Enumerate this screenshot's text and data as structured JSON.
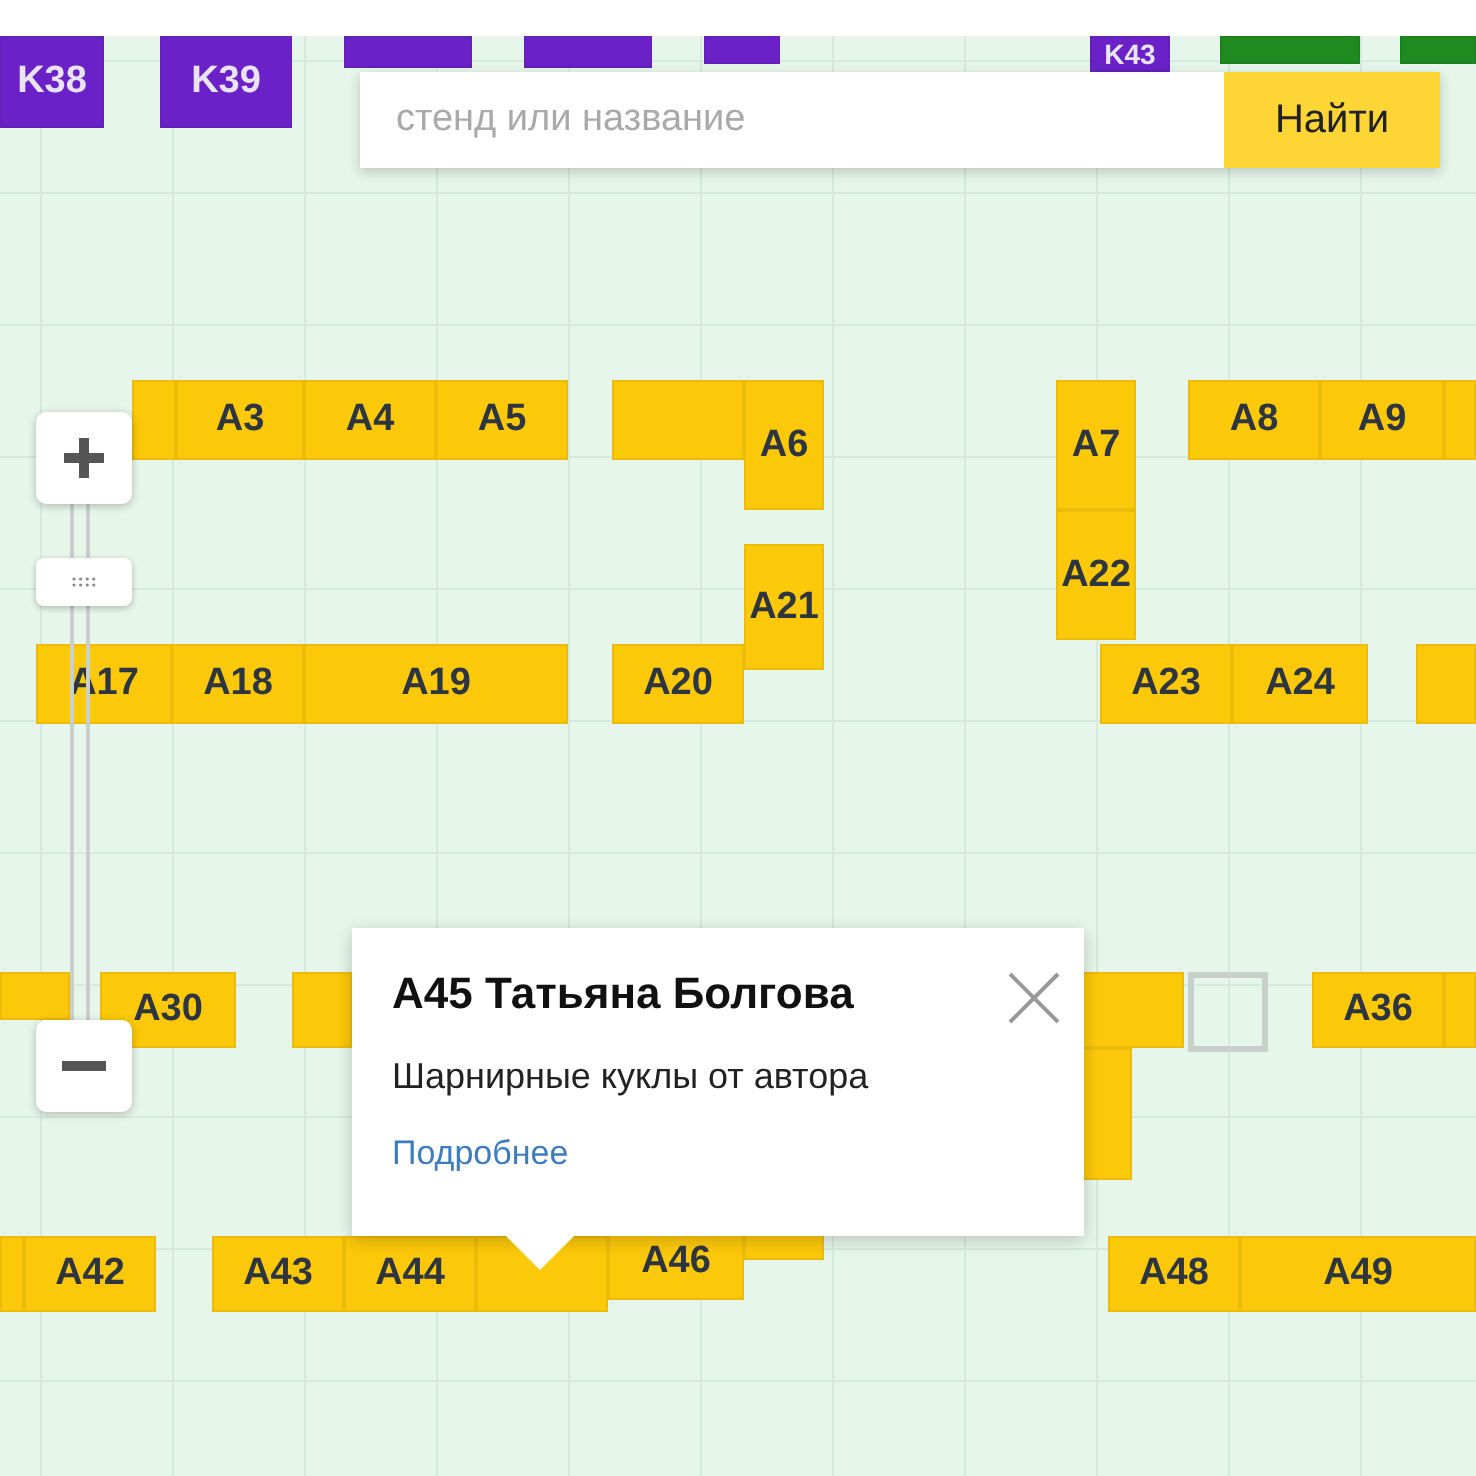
{
  "search": {
    "placeholder": "стенд или название",
    "button": "Найти"
  },
  "booths": [
    {
      "label": "K38",
      "kind": "stand",
      "color": "#6a22c8"
    },
    {
      "label": "K39",
      "kind": "stand",
      "color": "#6a22c8"
    },
    {
      "kind": "stand",
      "color": "#6a22c8"
    },
    {
      "kind": "stand",
      "color": "#6a22c8"
    },
    {
      "kind": "stand",
      "color": "#6a22c8"
    },
    {
      "label": "K43",
      "kind": "stand",
      "color": "#6a22c8"
    },
    {
      "kind": "stand",
      "color": "#1f8a1f"
    },
    {
      "kind": "stand",
      "color": "#1f8a1f"
    },
    {
      "kind": "stand",
      "color": "#fcc80a"
    },
    {
      "label": "A3",
      "kind": "stand",
      "color": "#fcc80a"
    },
    {
      "label": "A4",
      "kind": "stand",
      "color": "#fcc80a"
    },
    {
      "label": "A5",
      "kind": "stand",
      "color": "#fcc80a"
    },
    {
      "kind": "stand",
      "color": "#fcc80a"
    },
    {
      "label": "A6",
      "kind": "stand",
      "color": "#fcc80a"
    },
    {
      "label": "A21",
      "kind": "stand",
      "color": "#fcc80a"
    },
    {
      "label": "A7",
      "kind": "stand",
      "color": "#fcc80a"
    },
    {
      "label": "A22",
      "kind": "stand",
      "color": "#fcc80a"
    },
    {
      "label": "A8",
      "kind": "stand",
      "color": "#fcc80a"
    },
    {
      "label": "A9",
      "kind": "stand",
      "color": "#fcc80a"
    },
    {
      "kind": "stand",
      "color": "#fcc80a"
    },
    {
      "label": "A17",
      "kind": "stand",
      "color": "#fcc80a"
    },
    {
      "label": "A18",
      "kind": "stand",
      "color": "#fcc80a"
    },
    {
      "label": "A19",
      "kind": "stand",
      "color": "#fcc80a"
    },
    {
      "label": "A20",
      "kind": "stand",
      "color": "#fcc80a"
    },
    {
      "label": "A23",
      "kind": "stand",
      "color": "#fcc80a"
    },
    {
      "label": "A24",
      "kind": "stand",
      "color": "#fcc80a"
    },
    {
      "kind": "stand",
      "color": "#fcc80a"
    },
    {
      "kind": "stand",
      "color": "#fcc80a"
    },
    {
      "label": "A30",
      "kind": "stand",
      "color": "#fcc80a"
    },
    {
      "kind": "stand",
      "color": "#fcc80a"
    },
    {
      "kind": "stand",
      "color": "#fcc80a"
    },
    {
      "kind": "outline",
      "color": "#c8d0cc"
    },
    {
      "label": "A36",
      "kind": "stand",
      "color": "#fcc80a"
    },
    {
      "kind": "stand",
      "color": "#fcc80a"
    },
    {
      "kind": "stand",
      "color": "#fcc80a"
    },
    {
      "kind": "stand",
      "color": "#fcc80a"
    },
    {
      "label": "A42",
      "kind": "stand",
      "color": "#fcc80a"
    },
    {
      "label": "A43",
      "kind": "stand",
      "color": "#fcc80a"
    },
    {
      "label": "A44",
      "kind": "stand",
      "color": "#fcc80a"
    },
    {
      "kind": "stand",
      "color": "#fcc80a"
    },
    {
      "label": "A46",
      "kind": "stand",
      "color": "#fcc80a"
    },
    {
      "kind": "stand",
      "color": "#fcc80a"
    },
    {
      "label": "A48",
      "kind": "stand",
      "color": "#fcc80a"
    },
    {
      "label": "A49",
      "kind": "stand",
      "color": "#fcc80a"
    }
  ],
  "zoom": {
    "level": 0.85
  },
  "popup": {
    "title": "A45 Татьяна Болгова",
    "description": "Шарнирные куклы от автора",
    "link": "Подробнее"
  }
}
